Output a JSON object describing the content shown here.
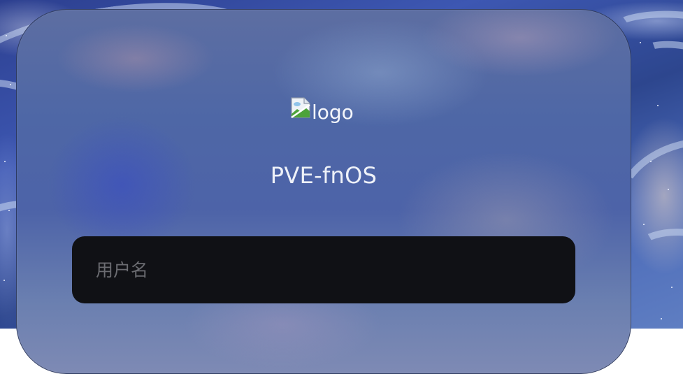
{
  "logo": {
    "alt_text": "logo",
    "icon": "broken-image-icon"
  },
  "site": {
    "title": "PVE-fnOS"
  },
  "login": {
    "username_placeholder": "用户名",
    "username_value": ""
  },
  "colors": {
    "input_background": "#101115",
    "title_text": "#eef1f8",
    "placeholder_text": "#6b6c71"
  }
}
